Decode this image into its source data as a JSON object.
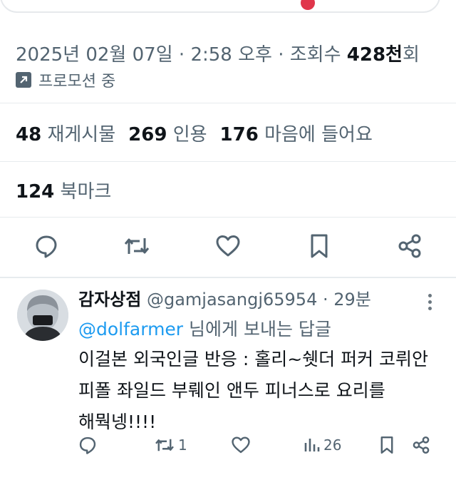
{
  "meta": {
    "date": "2025년 02월 07일",
    "sep1": "·",
    "time": "2:58 오후",
    "sep2": "·",
    "views_label": "조회수",
    "views_value": "428천",
    "views_suffix": "회"
  },
  "promo": {
    "label": "프로모션 중",
    "icon": "arrow-up-right-icon"
  },
  "stats": {
    "reposts_num": "48",
    "reposts_label": "재게시물",
    "quotes_num": "269",
    "quotes_label": "인용",
    "likes_num": "176",
    "likes_label": "마음에 들어요",
    "bookmarks_num": "124",
    "bookmarks_label": "북마크"
  },
  "actions": [
    "reply-icon",
    "repost-icon",
    "like-icon",
    "bookmark-icon",
    "share-icon"
  ],
  "reply": {
    "name": "감자상점",
    "handle": "@gamjasangj65954",
    "sep": "·",
    "time": "29분",
    "reply_to_handle": "@dolfarmer",
    "reply_to_suffix": " 님에게 보내는 답글",
    "body_line1": "이걸본 외국인글 반응 : 홀리~쉣더 퍼커 코뤼안",
    "body_line2": "피폴 좌일드 부뤠인 앤두 피너스로 요리를",
    "body_line3": "해뭑넹!!!!",
    "retweet_count": "1",
    "views_count": "26"
  },
  "colors": {
    "accent": "#1d9bf0",
    "muted": "#536471",
    "text": "#0f1419",
    "promo_dot": "#e0364b"
  }
}
